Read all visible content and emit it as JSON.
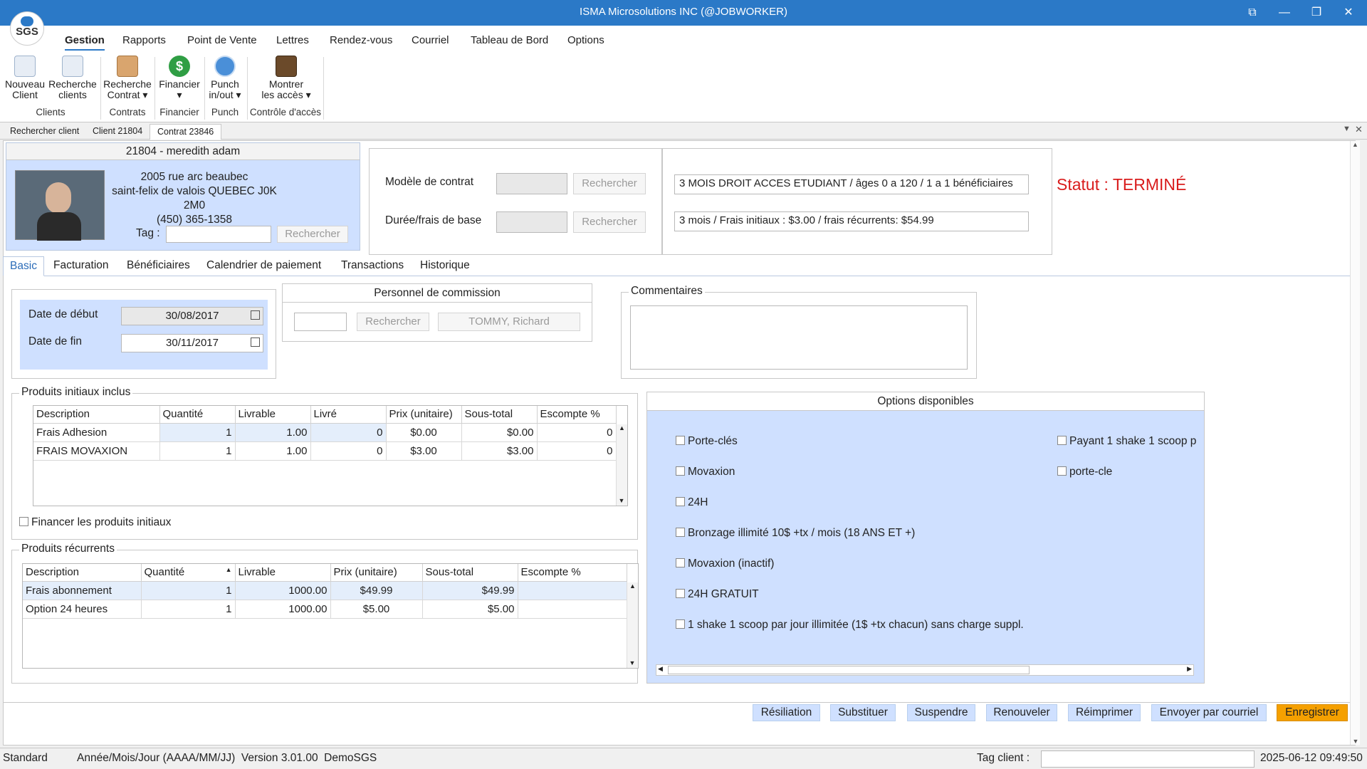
{
  "window": {
    "title": "ISMA Microsolutions INC (@JOBWORKER)",
    "logo_text": "SGS",
    "controls": [
      "⧉",
      "—",
      "❐",
      "✕"
    ]
  },
  "menu": [
    "Gestion",
    "Rapports",
    "Point de Vente",
    "Lettres",
    "Rendez-vous",
    "Courriel",
    "Tableau de Bord",
    "Options"
  ],
  "ribbon": {
    "buttons": [
      {
        "line1": "Nouveau",
        "line2": "Client",
        "icon": "new-client-icon"
      },
      {
        "line1": "Recherche",
        "line2": "clients",
        "icon": "search-clients-icon"
      },
      {
        "line1": "Recherche",
        "line2": "Contrat ▾",
        "icon": "search-contract-icon"
      },
      {
        "line1": "Financier",
        "line2": "▾",
        "icon": "dollar-icon"
      },
      {
        "line1": "Punch",
        "line2": "in/out ▾",
        "icon": "clock-icon"
      },
      {
        "line1": "Montrer",
        "line2": "les accès ▾",
        "icon": "door-icon"
      }
    ],
    "groups": [
      "Clients",
      "Contrats",
      "Financier",
      "Punch",
      "Contrôle d'accès"
    ]
  },
  "doc_tabs": [
    "Rechercher client",
    "Client 21804",
    "Contrat 23846"
  ],
  "client": {
    "header": "21804 - meredith adam",
    "address1": "2005 rue arc beaubec",
    "address2": "saint-felix de valois QUEBEC J0K 2M0",
    "phone": "(450) 365-1358",
    "tag_label": "Tag :",
    "tag_value": "",
    "search_label": "Rechercher"
  },
  "contract": {
    "model_label": "Modèle de contrat",
    "duration_label": "Durée/frais de base",
    "search_label": "Rechercher",
    "model_value": "3 MOIS DROIT ACCES ETUDIANT / âges 0 a 120 / 1 a 1 bénéficiaires",
    "duration_value": "3 mois / Frais initiaux : $3.00 / frais récurrents: $54.99",
    "status": "Statut : TERMINÉ"
  },
  "subtabs": [
    "Basic",
    "Facturation",
    "Bénéficiaires",
    "Calendrier de paiement",
    "Transactions",
    "Historique"
  ],
  "dates": {
    "start_label": "Date de début",
    "start_value": "30/08/2017",
    "end_label": "Date de fin",
    "end_value": "30/11/2017"
  },
  "commission": {
    "title": "Personnel de commission",
    "search_label": "Rechercher",
    "name": "TOMMY, Richard"
  },
  "comments": {
    "title": "Commentaires",
    "value": ""
  },
  "initial_products": {
    "title": "Produits initiaux inclus",
    "columns": [
      "Description",
      "Quantité",
      "Livrable",
      "Livré",
      "Prix (unitaire)",
      "Sous-total",
      "Escompte %"
    ],
    "rows": [
      [
        "Frais Adhesion",
        "1",
        "1.00",
        "0",
        "$0.00",
        "$0.00",
        "0"
      ],
      [
        "FRAIS MOVAXION",
        "1",
        "1.00",
        "0",
        "$3.00",
        "$3.00",
        "0"
      ]
    ],
    "finance_label": "Financer les produits initiaux"
  },
  "recurring_products": {
    "title": "Produits récurrents",
    "columns": [
      "Description",
      "Quantité",
      "Livrable",
      "Prix (unitaire)",
      "Sous-total",
      "Escompte %"
    ],
    "rows": [
      [
        "Frais abonnement",
        "1",
        "1000.00",
        "$49.99",
        "$49.99",
        ""
      ],
      [
        "Option 24 heures",
        "1",
        "1000.00",
        "$5.00",
        "$5.00",
        ""
      ]
    ]
  },
  "options": {
    "title": "Options disponibles",
    "left": [
      "Porte-clés",
      "Movaxion",
      "24H",
      "Bronzage illimité 10$ +tx / mois (18 ANS ET +)",
      "Movaxion (inactif)",
      "24H GRATUIT",
      "1 shake 1 scoop par jour illimitée (1$ +tx chacun) sans charge suppl."
    ],
    "right": [
      "Payant 1 shake 1 scoop p",
      "porte-cle"
    ]
  },
  "actions": [
    "Résiliation",
    "Substituer",
    "Suspendre",
    "Renouveler",
    "Réimprimer",
    "Envoyer par courriel",
    "Enregistrer"
  ],
  "status": {
    "mode": "Standard",
    "info": "Année/Mois/Jour (AAAA/MM/JJ)  Version 3.01.00  DemoSGS",
    "tag_label": "Tag client :",
    "datetime": "2025-06-12 09:49:50"
  }
}
